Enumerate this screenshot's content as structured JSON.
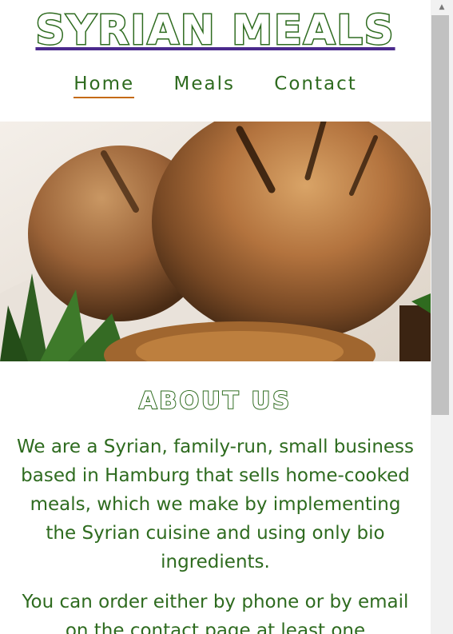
{
  "site": {
    "title": "SYRIAN MEALS"
  },
  "nav": {
    "items": [
      {
        "label": "Home",
        "active": true
      },
      {
        "label": "Meals",
        "active": false
      },
      {
        "label": "Contact",
        "active": false
      }
    ]
  },
  "hero": {
    "icon": "food-photo"
  },
  "about": {
    "title": "ABOUT US",
    "paragraph_1": "We are a Syrian, family-run, small business based in Hamburg that sells home-cooked meals, which we make by implementing the Syrian cuisine and using only bio ingredients.",
    "paragraph_2": "You can order either by phone or by email on the contact page at least one"
  },
  "colors": {
    "accent_green": "#2e6b1f",
    "underline_purple": "#4b2a8c",
    "active_underline": "#c56a12"
  }
}
